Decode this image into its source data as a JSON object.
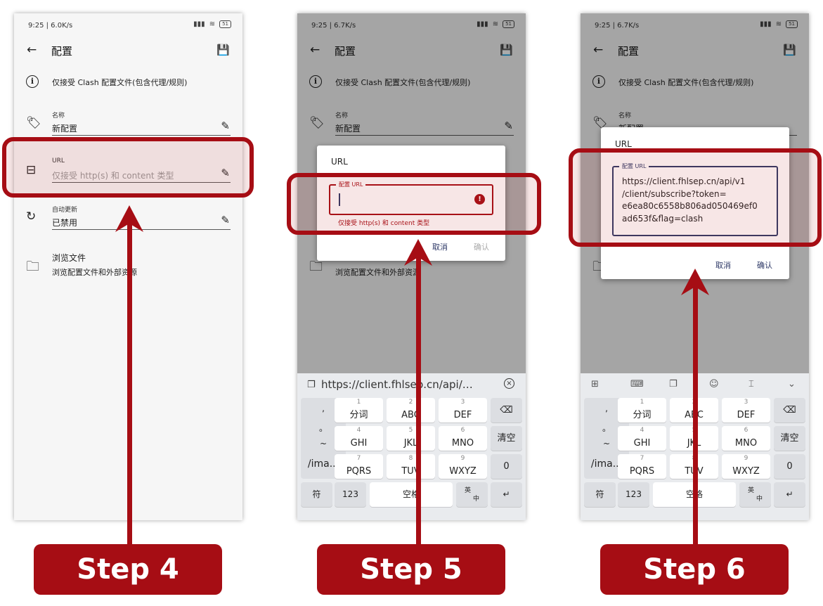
{
  "colors": {
    "accent": "#a60d14",
    "field_border": "#2d3866"
  },
  "screen1": {
    "status": "9:25 | 6.0K/s",
    "battery": "51",
    "title": "配置",
    "info": "仅接受 Clash 配置文件(包含代理/规则)",
    "name_label": "名称",
    "name_value": "新配置",
    "url_label": "URL",
    "url_placeholder": "仅接受 http(s) 和 content 类型",
    "auto_label": "自动更新",
    "auto_value": "已禁用",
    "browse_title": "浏览文件",
    "browse_sub": "浏览配置文件和外部资源"
  },
  "screen2": {
    "status": "9:25 | 6.7K/s",
    "battery": "51",
    "title": "配置",
    "info": "仅接受 Clash 配置文件(包含代理/规则)",
    "name_label": "名称",
    "name_value": "新配置",
    "browse_sub": "浏览配置文件和外部资源",
    "dialog": {
      "title": "URL",
      "field_label": "配置 URL",
      "error": "仅接受 http(s) 和 content 类型",
      "cancel": "取消",
      "confirm": "确认"
    },
    "clipboard": "https://client.fhlsep.cn/api/…"
  },
  "screen3": {
    "status": "9:25 | 6.7K/s",
    "battery": "51",
    "title": "配置",
    "info": "仅接受 Clash 配置文件(包含代理/规则)",
    "name_label": "名称",
    "name_value": "新配置",
    "dialog": {
      "title": "URL",
      "field_label": "配置 URL",
      "value_lines": [
        "https://client.fhlsep.cn/api/v1",
        "/client/subscribe?token=",
        "e6ea80c6558b806ad050469ef0",
        "ad653f&flag=clash"
      ],
      "cancel": "取消",
      "confirm": "确认"
    }
  },
  "keyboard": {
    "side_keys": [
      ",",
      "。",
      "~",
      "/ima..."
    ],
    "keys": [
      {
        "num": "1",
        "letters": "分词"
      },
      {
        "num": "2",
        "letters": "ABC"
      },
      {
        "num": "3",
        "letters": "DEF"
      },
      {
        "num": "4",
        "letters": "GHI"
      },
      {
        "num": "5",
        "letters": "JKL"
      },
      {
        "num": "6",
        "letters": "MNO"
      },
      {
        "num": "7",
        "letters": "PQRS"
      },
      {
        "num": "8",
        "letters": "TUV"
      },
      {
        "num": "9",
        "letters": "WXYZ"
      }
    ],
    "backspace": "⌫",
    "clear": "清空",
    "zero": "0",
    "symbol": "符",
    "num_mode": "123",
    "space": "空格",
    "lang_top": "英",
    "lang_bottom": "中",
    "enter": "↵"
  },
  "steps": [
    "Step 4",
    "Step 5",
    "Step 6"
  ]
}
